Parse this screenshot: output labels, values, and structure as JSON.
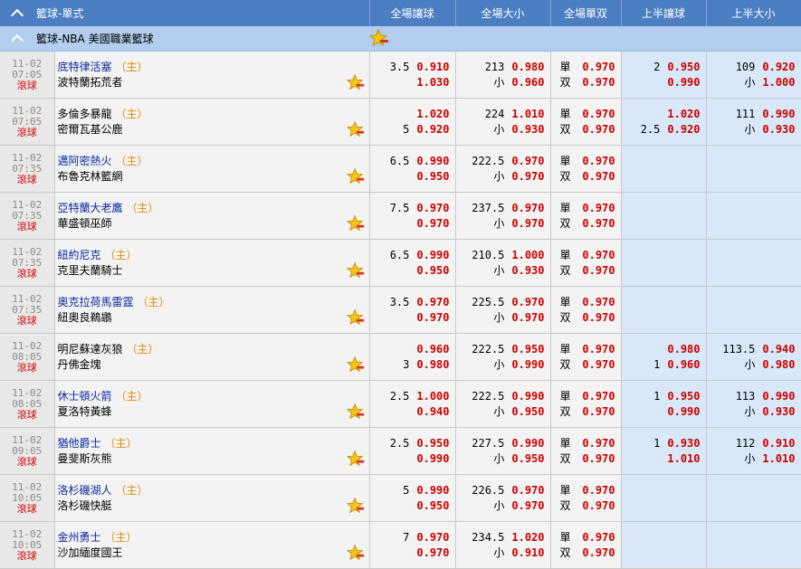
{
  "header": {
    "section": "籃球-單式",
    "columns": [
      "全場讓球",
      "全場大小",
      "全場單双",
      "上半讓球",
      "上半大小"
    ]
  },
  "league": {
    "name": "籃球-NBA 美國職業籃球"
  },
  "labels": {
    "small": "小",
    "odd": "單",
    "even": "双",
    "home": "（主）"
  },
  "matches": [
    {
      "date": "11-02",
      "time": "07:05",
      "status": "滾球",
      "team1": "底特律活塞",
      "team1_fav": true,
      "team2": "波特蘭拓荒者",
      "home": 1,
      "hdp": {
        "l1": "3.5",
        "p1": "0.910",
        "l2": "",
        "p2": "1.030"
      },
      "ou": {
        "l1": "213",
        "p1": "0.980",
        "l2": "小",
        "p2": "0.960"
      },
      "oe": {
        "p1": "0.970",
        "p2": "0.970"
      },
      "h1hdp": {
        "l1": "2",
        "p1": "0.950",
        "l2": "",
        "p2": "0.990"
      },
      "h1ou": {
        "l1": "109",
        "p1": "0.920",
        "l2": "小",
        "p2": "1.000"
      }
    },
    {
      "date": "11-02",
      "time": "07:05",
      "status": "滾球",
      "team1": "多倫多暴龍",
      "team1_fav": false,
      "team2": "密爾瓦基公鹿",
      "home": 1,
      "hdp": {
        "l1": "",
        "p1": "1.020",
        "l2": "5",
        "p2": "0.920"
      },
      "ou": {
        "l1": "224",
        "p1": "1.010",
        "l2": "小",
        "p2": "0.930"
      },
      "oe": {
        "p1": "0.970",
        "p2": "0.970"
      },
      "h1hdp": {
        "l1": "",
        "p1": "1.020",
        "l2": "2.5",
        "p2": "0.920"
      },
      "h1ou": {
        "l1": "111",
        "p1": "0.990",
        "l2": "小",
        "p2": "0.930"
      }
    },
    {
      "date": "11-02",
      "time": "07:35",
      "status": "滾球",
      "team1": "邁阿密熱火",
      "team1_fav": true,
      "team2": "布魯克林籃網",
      "home": 1,
      "hdp": {
        "l1": "6.5",
        "p1": "0.990",
        "l2": "",
        "p2": "0.950"
      },
      "ou": {
        "l1": "222.5",
        "p1": "0.970",
        "l2": "小",
        "p2": "0.970"
      },
      "oe": {
        "p1": "0.970",
        "p2": "0.970"
      },
      "h1hdp": null,
      "h1ou": null
    },
    {
      "date": "11-02",
      "time": "07:35",
      "status": "滾球",
      "team1": "亞特蘭大老鷹",
      "team1_fav": true,
      "team2": "華盛頓巫師",
      "home": 1,
      "hdp": {
        "l1": "7.5",
        "p1": "0.970",
        "l2": "",
        "p2": "0.970"
      },
      "ou": {
        "l1": "237.5",
        "p1": "0.970",
        "l2": "小",
        "p2": "0.970"
      },
      "oe": {
        "p1": "0.970",
        "p2": "0.970"
      },
      "h1hdp": null,
      "h1ou": null
    },
    {
      "date": "11-02",
      "time": "07:35",
      "status": "滾球",
      "team1": "紐約尼克",
      "team1_fav": true,
      "team2": "克里夫蘭騎士",
      "home": 1,
      "hdp": {
        "l1": "6.5",
        "p1": "0.990",
        "l2": "",
        "p2": "0.950"
      },
      "ou": {
        "l1": "210.5",
        "p1": "1.000",
        "l2": "小",
        "p2": "0.930"
      },
      "oe": {
        "p1": "0.970",
        "p2": "0.970"
      },
      "h1hdp": null,
      "h1ou": null
    },
    {
      "date": "11-02",
      "time": "07:35",
      "status": "滾球",
      "team1": "奧克拉荷馬雷霆",
      "team1_fav": true,
      "team2": "紐奧良鵜鶘",
      "home": 1,
      "hdp": {
        "l1": "3.5",
        "p1": "0.970",
        "l2": "",
        "p2": "0.970"
      },
      "ou": {
        "l1": "225.5",
        "p1": "0.970",
        "l2": "小",
        "p2": "0.970"
      },
      "oe": {
        "p1": "0.970",
        "p2": "0.970"
      },
      "h1hdp": null,
      "h1ou": null
    },
    {
      "date": "11-02",
      "time": "08:05",
      "status": "滾球",
      "team1": "明尼蘇達灰狼",
      "team1_fav": false,
      "team2": "丹佛金塊",
      "home": 1,
      "hdp": {
        "l1": "",
        "p1": "0.960",
        "l2": "3",
        "p2": "0.980"
      },
      "ou": {
        "l1": "222.5",
        "p1": "0.950",
        "l2": "小",
        "p2": "0.990"
      },
      "oe": {
        "p1": "0.970",
        "p2": "0.970"
      },
      "h1hdp": {
        "l1": "",
        "p1": "0.980",
        "l2": "1",
        "p2": "0.960"
      },
      "h1ou": {
        "l1": "113.5",
        "p1": "0.940",
        "l2": "小",
        "p2": "0.980"
      }
    },
    {
      "date": "11-02",
      "time": "08:05",
      "status": "滾球",
      "team1": "休士頓火箭",
      "team1_fav": true,
      "team2": "夏洛特黃蜂",
      "home": 1,
      "hdp": {
        "l1": "2.5",
        "p1": "1.000",
        "l2": "",
        "p2": "0.940"
      },
      "ou": {
        "l1": "222.5",
        "p1": "0.990",
        "l2": "小",
        "p2": "0.950"
      },
      "oe": {
        "p1": "0.970",
        "p2": "0.970"
      },
      "h1hdp": {
        "l1": "1",
        "p1": "0.950",
        "l2": "",
        "p2": "0.990"
      },
      "h1ou": {
        "l1": "113",
        "p1": "0.990",
        "l2": "小",
        "p2": "0.930"
      }
    },
    {
      "date": "11-02",
      "time": "09:05",
      "status": "滾球",
      "team1": "猶他爵士",
      "team1_fav": true,
      "team2": "曼斐斯灰熊",
      "home": 1,
      "hdp": {
        "l1": "2.5",
        "p1": "0.950",
        "l2": "",
        "p2": "0.990"
      },
      "ou": {
        "l1": "227.5",
        "p1": "0.990",
        "l2": "小",
        "p2": "0.950"
      },
      "oe": {
        "p1": "0.970",
        "p2": "0.970"
      },
      "h1hdp": {
        "l1": "1",
        "p1": "0.930",
        "l2": "",
        "p2": "1.010"
      },
      "h1ou": {
        "l1": "112",
        "p1": "0.910",
        "l2": "小",
        "p2": "1.010"
      }
    },
    {
      "date": "11-02",
      "time": "10:05",
      "status": "滾球",
      "team1": "洛杉磯湖人",
      "team1_fav": true,
      "team2": "洛杉磯快艇",
      "home": 1,
      "hdp": {
        "l1": "5",
        "p1": "0.990",
        "l2": "",
        "p2": "0.950"
      },
      "ou": {
        "l1": "226.5",
        "p1": "0.970",
        "l2": "小",
        "p2": "0.970"
      },
      "oe": {
        "p1": "0.970",
        "p2": "0.970"
      },
      "h1hdp": null,
      "h1ou": null
    },
    {
      "date": "11-02",
      "time": "10:05",
      "status": "滾球",
      "team1": "金州勇士",
      "team1_fav": true,
      "team2": "沙加緬度國王",
      "home": 1,
      "hdp": {
        "l1": "7",
        "p1": "0.970",
        "l2": "",
        "p2": "0.970"
      },
      "ou": {
        "l1": "234.5",
        "p1": "1.020",
        "l2": "小",
        "p2": "0.910"
      },
      "oe": {
        "p1": "0.970",
        "p2": "0.970"
      },
      "h1hdp": null,
      "h1ou": null
    }
  ],
  "colors": {
    "header_bg": "#4b7fc1",
    "league_bg": "#b3cdee",
    "odds_red": "#cc0000",
    "fav_blue": "#0d2aa0",
    "home_orange": "#e68a00",
    "live_red": "#d50000",
    "first_half_bg": "#d8e8f8"
  }
}
